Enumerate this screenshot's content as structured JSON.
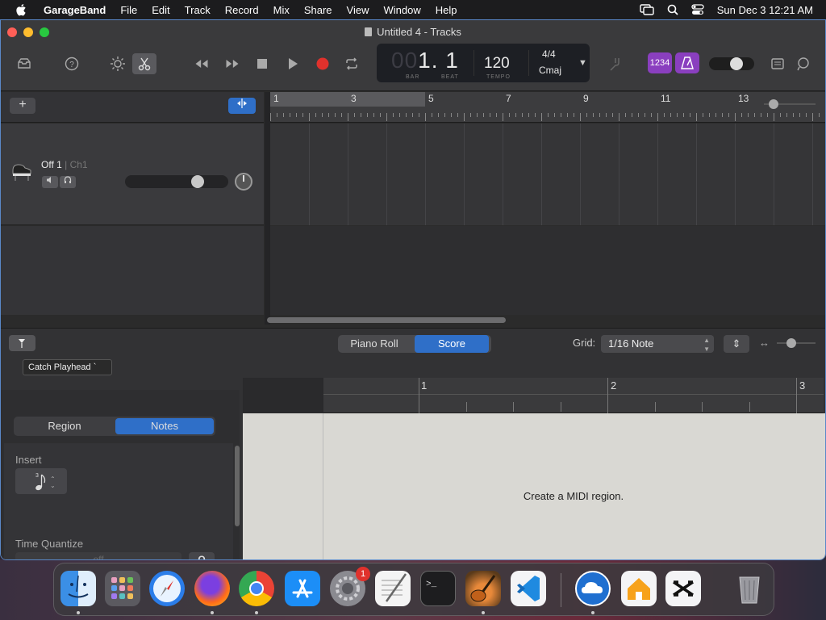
{
  "menubar": {
    "app_name": "GarageBand",
    "items": [
      "File",
      "Edit",
      "Track",
      "Record",
      "Mix",
      "Share",
      "View",
      "Window",
      "Help"
    ],
    "clock": "Sun Dec 3  12:21 AM",
    "icons": [
      "apple-icon",
      "screen-mirroring-icon",
      "spotlight-search-icon",
      "control-center-icon"
    ]
  },
  "window": {
    "title": "Untitled 4 - Tracks"
  },
  "control_bar": {
    "lcd": {
      "bar_dim": "00",
      "position": "1. 1",
      "bar_label": "BAR",
      "beat_label": "BEAT",
      "tempo": "120",
      "tempo_label": "TEMPO",
      "time_signature": "4/4",
      "key": "Cmaj"
    },
    "count_in_label": "1234",
    "colors": {
      "purple_toggle": "#8a3fbf",
      "record": "#e0312c",
      "blue_accent": "#2f6fc8"
    }
  },
  "tracks": {
    "add_label": "+",
    "track": {
      "name": "Off 1",
      "channel": " | Ch1"
    }
  },
  "arrange": {
    "ruler_bars": [
      "1",
      "3",
      "5",
      "7",
      "9",
      "11",
      "13"
    ]
  },
  "editor": {
    "tooltip": "Catch Playhead  `",
    "tabs": {
      "piano_roll": "Piano Roll",
      "score": "Score"
    },
    "grid_label": "Grid:",
    "grid_value": "1/16 Note",
    "inspector_tabs": {
      "region": "Region",
      "notes": "Notes"
    },
    "insert_label": "Insert",
    "time_quantize_label": "Time Quantize",
    "time_quantize_value": "off",
    "quantize_button": "Q",
    "ruler_bars": [
      "1",
      "2",
      "3"
    ],
    "message": "Create a MIDI region."
  },
  "dock": {
    "apps": [
      "Finder",
      "Launchpad",
      "Safari",
      "Firefox",
      "Chrome",
      "App Store",
      "System Settings",
      "TextEdit",
      "Terminal",
      "GarageBand",
      "VS Code",
      "Sync App",
      "Home",
      "CapCut",
      "Trash"
    ],
    "settings_badge": "1"
  }
}
